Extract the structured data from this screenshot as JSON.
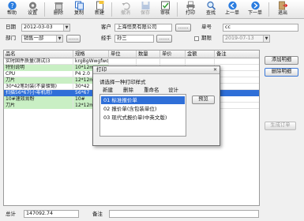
{
  "toolbar": {
    "help": "帮助",
    "settings": "设置",
    "delete": "删除",
    "copy": "复制",
    "new": "新建",
    "undo": "撤消",
    "save": "保存",
    "audit": "审核",
    "print": "打印",
    "find": "查找",
    "prev": "上一单",
    "next": "下一单",
    "exit": "退出"
  },
  "form": {
    "date_label": "日期",
    "date_value": "2012-03-03",
    "customer_label": "客户",
    "customer_value": "上海恒昊有限公司",
    "order_no_label": "单号",
    "order_no_value": "cc",
    "dept_label": "部门",
    "dept_value": "销售一部",
    "handler_label": "经手",
    "handler_value": "孙三",
    "due_label": "期限",
    "due_value": "2019-07-13",
    "ellipsis": "……"
  },
  "grid": {
    "headers": [
      "品名",
      "规格",
      "单位",
      "数量",
      "单价",
      "金额",
      "备注"
    ],
    "rows": [
      [
        "实时固件质量(测试)3",
        "krgBgWwgfwd",
        "",
        "",
        "",
        "",
        ""
      ],
      [
        "特别说明",
        "10*12mm",
        "",
        "",
        "",
        "",
        ""
      ],
      [
        "CPU",
        "P4 2.0",
        "",
        "",
        "",
        "",
        ""
      ],
      [
        "刀片",
        "12*12mm",
        "",
        "",
        "",
        "",
        ""
      ],
      [
        "30*42笔封装(不要镀锡)",
        "30*42",
        "",
        "",
        "",
        "",
        ""
      ],
      [
        "扫描56*67(小零机用)",
        "56*67",
        "",
        "",
        "",
        "",
        ""
      ],
      [
        "10#速效膏粉",
        "10#",
        "",
        "",
        "",
        "",
        ""
      ],
      [
        "刀片",
        "12*12mm",
        "",
        "",
        "",
        "",
        ""
      ]
    ]
  },
  "side_buttons": {
    "add": "添加明细",
    "remove": "删除明细",
    "generate": "生成订单"
  },
  "footer": {
    "total_label": "总计",
    "total_value": "147092.74",
    "note_label": "备注"
  },
  "dialog": {
    "title": "打印",
    "prompt": "请选择一种打印样式",
    "menu": [
      "新建",
      "删除",
      "重命名",
      "设计"
    ],
    "options": [
      "01 标准报价单",
      "02 报价单(含包装单位)",
      "03 现代式报价单(中英文版)"
    ],
    "selected_index": 0,
    "print_button": "预览"
  },
  "colors": {
    "selection": "#2f6fd8",
    "row_green": "#c9efc4"
  }
}
